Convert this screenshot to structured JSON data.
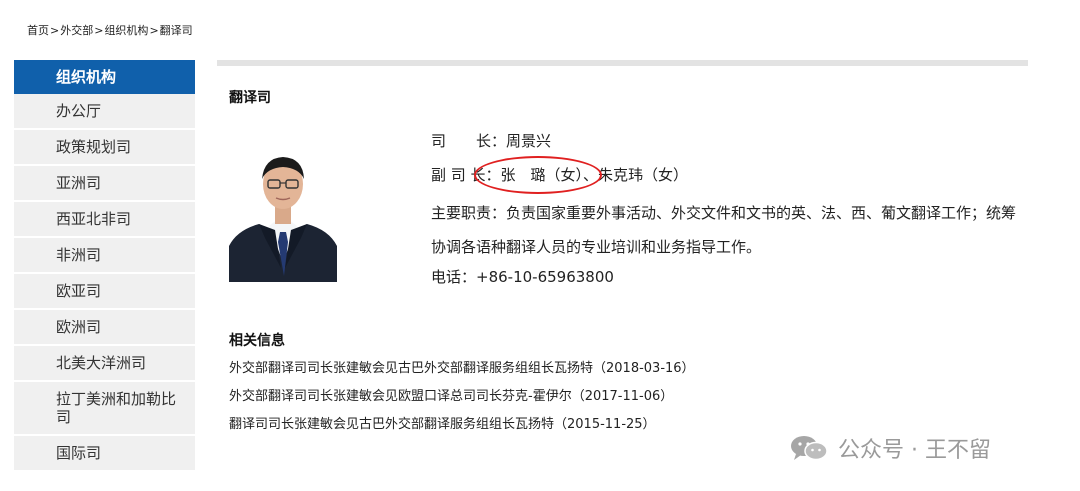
{
  "breadcrumb": [
    {
      "label": "首页"
    },
    {
      "label": "外交部"
    },
    {
      "label": "组织机构"
    },
    {
      "label": "翻译司"
    }
  ],
  "breadcrumb_sep": ">",
  "sidebar": {
    "title": "组织机构",
    "items": [
      {
        "label": "办公厅"
      },
      {
        "label": "政策规划司"
      },
      {
        "label": "亚洲司"
      },
      {
        "label": "西亚北非司"
      },
      {
        "label": "非洲司"
      },
      {
        "label": "欧亚司"
      },
      {
        "label": "欧洲司"
      },
      {
        "label": "北美大洋洲司"
      },
      {
        "label": "拉丁美洲和加勒比司"
      },
      {
        "label": "国际司"
      }
    ]
  },
  "page": {
    "title": "翻译司",
    "director": "司　　长：周景兴",
    "deputy": "副 司 长：张　璐（女）、朱克玮（女）",
    "duty": "主要职责：负责国家重要外事活动、外交文件和文书的英、法、西、葡文翻译工作；统筹协调各语种翻译人员的专业培训和业务指导工作。",
    "phone": "电话：+86-10-65963800"
  },
  "related": {
    "title": "相关信息",
    "items": [
      {
        "label": "外交部翻译司司长张建敏会见古巴外交部翻译服务组组长瓦扬特（2018-03-16）"
      },
      {
        "label": "外交部翻译司司长张建敏会见欧盟口译总司司长芬克-霍伊尔（2017-11-06）"
      },
      {
        "label": "翻译司司长张建敏会见古巴外交部翻译服务组组长瓦扬特（2015-11-25）"
      }
    ]
  },
  "watermark": {
    "text": "公众号 · 王不留",
    "icon": "wechat-icon"
  },
  "colors": {
    "sidebar_active": "#1060ab",
    "annotation": "#e02020"
  }
}
